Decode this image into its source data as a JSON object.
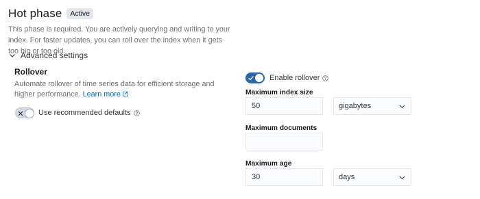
{
  "phase": {
    "title": "Hot phase",
    "badge": "Active",
    "description": "This phase is required. You are actively querying and writing to your index. For faster updates, you can roll over the index when it gets too big or too old."
  },
  "advanced": {
    "label": "Advanced settings",
    "expanded": true,
    "icon": "chevron-down-icon"
  },
  "rollover": {
    "title": "Rollover",
    "description": "Automate rollover of time series data for efficient storage and higher performance.",
    "learn_more": "Learn more",
    "recommended_defaults": {
      "label": "Use recommended defaults",
      "checked": false
    },
    "enable_rollover": {
      "label": "Enable rollover",
      "checked": true
    },
    "max_index_size": {
      "label": "Maximum index size",
      "value": "50",
      "unit": "gigabytes"
    },
    "max_documents": {
      "label": "Maximum documents",
      "value": ""
    },
    "max_age": {
      "label": "Maximum age",
      "value": "30",
      "unit": "days"
    }
  },
  "colors": {
    "accent": "#2c65a8",
    "link": "#006bb8",
    "badge_bg": "#e0e5ee"
  }
}
